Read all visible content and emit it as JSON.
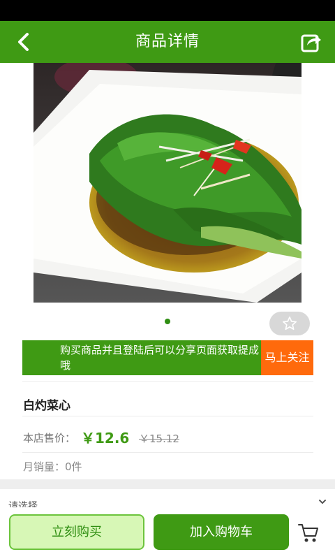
{
  "header": {
    "title": "商品详情",
    "back_icon": "chevron-left-icon",
    "share_icon": "share-icon"
  },
  "gallery": {
    "image": "plate of blanched choy sum with chili and ginger in soy sauce",
    "page_count": 1,
    "active_page": 1,
    "favorite_icon": "star-outline-icon"
  },
  "promo": {
    "text": "购买商品并且登陆后可以分享页面获取提成哦",
    "follow_label": "马上关注"
  },
  "product": {
    "name": "白灼菜心",
    "price_label": "本店售价：",
    "price": "￥12.6",
    "original_price": "￥15.12",
    "monthly_sales": "月销量：0件"
  },
  "options": {
    "label": "请选择",
    "chevron_icon": "chevron-down-icon"
  },
  "actions": {
    "buy_now": "立刻购买",
    "add_to_cart": "加入购物车",
    "cart_icon": "cart-icon"
  },
  "colors": {
    "brand_green": "#3f9a14",
    "promo_orange": "#ff6a0c",
    "buy_now_bg": "#d7f7b6"
  }
}
